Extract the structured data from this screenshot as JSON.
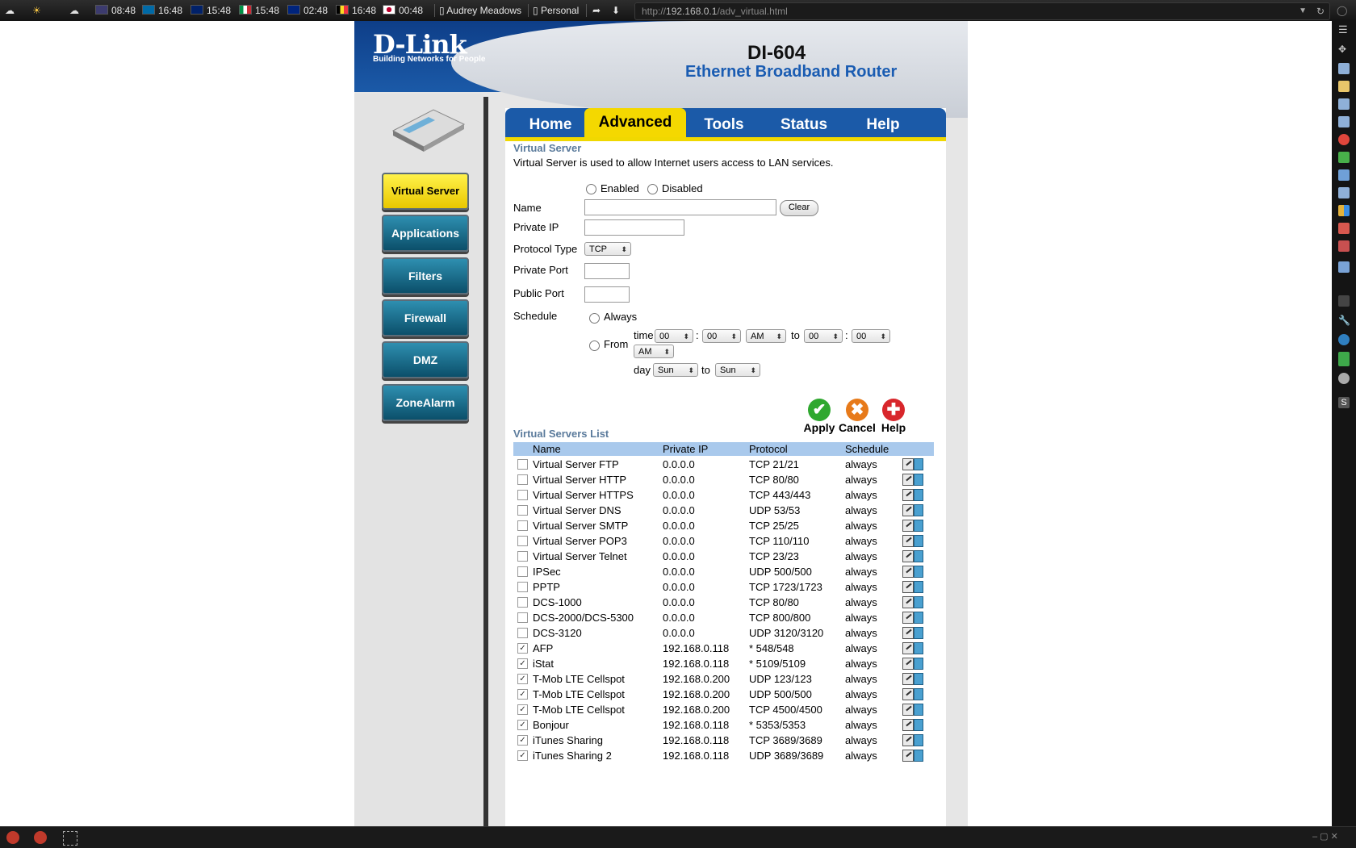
{
  "system_bar": {
    "clocks": [
      {
        "flag": "us",
        "time": "08:48"
      },
      {
        "flag": "se",
        "time": "16:48"
      },
      {
        "flag": "gb",
        "time": "15:48"
      },
      {
        "flag": "it",
        "time": "15:48"
      },
      {
        "flag": "au",
        "time": "02:48"
      },
      {
        "flag": "be",
        "time": "16:48"
      },
      {
        "flag": "jp",
        "time": "00:48"
      }
    ],
    "user": "Audrey Meadows",
    "profile": "Personal"
  },
  "browser": {
    "url_prefix": "http://",
    "url_host": "192.168.0.1",
    "url_path": "/adv_virtual.html"
  },
  "router": {
    "brand": "D-Link",
    "tagline": "Building Networks for People",
    "model": "DI-604",
    "product": "Ethernet Broadband Router"
  },
  "sidebar": {
    "items": [
      {
        "label": "Virtual Server",
        "active": true
      },
      {
        "label": "Applications",
        "active": false
      },
      {
        "label": "Filters",
        "active": false
      },
      {
        "label": "Firewall",
        "active": false
      },
      {
        "label": "DMZ",
        "active": false
      },
      {
        "label": "ZoneAlarm",
        "active": false
      }
    ]
  },
  "tabs": [
    {
      "label": "Home",
      "active": false
    },
    {
      "label": "Advanced",
      "active": true
    },
    {
      "label": "Tools",
      "active": false
    },
    {
      "label": "Status",
      "active": false
    },
    {
      "label": "Help",
      "active": false
    }
  ],
  "form": {
    "title": "Virtual Server",
    "description": "Virtual Server is used to allow Internet users access to LAN services.",
    "enabled_label": "Enabled",
    "disabled_label": "Disabled",
    "name_label": "Name",
    "name_value": "",
    "clear_label": "Clear",
    "private_ip_label": "Private IP",
    "private_ip_value": "",
    "protocol_label": "Protocol Type",
    "protocol_value": "TCP",
    "private_port_label": "Private Port",
    "private_port_value": "",
    "public_port_label": "Public Port",
    "public_port_value": "",
    "schedule_label": "Schedule",
    "always_label": "Always",
    "from_label": "From",
    "time_label": "time",
    "colon": ":",
    "to_label": "to",
    "day_label": "day",
    "from_hour": "00",
    "from_min": "00",
    "from_ampm": "AM",
    "to_hour": "00",
    "to_min": "00",
    "to_ampm": "AM",
    "from_day": "Sun",
    "to_day": "Sun"
  },
  "actions": {
    "apply": "Apply",
    "cancel": "Cancel",
    "help": "Help",
    "apply_color": "#2fa82f",
    "cancel_color": "#e77a1a",
    "help_color": "#d8262b"
  },
  "list": {
    "title": "Virtual Servers List",
    "columns": [
      "Name",
      "Private IP",
      "Protocol",
      "Schedule"
    ],
    "rows": [
      {
        "checked": false,
        "name": "Virtual Server FTP",
        "ip": "0.0.0.0",
        "protocol": "TCP 21/21",
        "schedule": "always"
      },
      {
        "checked": false,
        "name": "Virtual Server HTTP",
        "ip": "0.0.0.0",
        "protocol": "TCP 80/80",
        "schedule": "always"
      },
      {
        "checked": false,
        "name": "Virtual Server HTTPS",
        "ip": "0.0.0.0",
        "protocol": "TCP 443/443",
        "schedule": "always"
      },
      {
        "checked": false,
        "name": "Virtual Server DNS",
        "ip": "0.0.0.0",
        "protocol": "UDP 53/53",
        "schedule": "always"
      },
      {
        "checked": false,
        "name": "Virtual Server SMTP",
        "ip": "0.0.0.0",
        "protocol": "TCP 25/25",
        "schedule": "always"
      },
      {
        "checked": false,
        "name": "Virtual Server POP3",
        "ip": "0.0.0.0",
        "protocol": "TCP 110/110",
        "schedule": "always"
      },
      {
        "checked": false,
        "name": "Virtual Server Telnet",
        "ip": "0.0.0.0",
        "protocol": "TCP 23/23",
        "schedule": "always"
      },
      {
        "checked": false,
        "name": "IPSec",
        "ip": "0.0.0.0",
        "protocol": "UDP 500/500",
        "schedule": "always"
      },
      {
        "checked": false,
        "name": "PPTP",
        "ip": "0.0.0.0",
        "protocol": "TCP 1723/1723",
        "schedule": "always"
      },
      {
        "checked": false,
        "name": "DCS-1000",
        "ip": "0.0.0.0",
        "protocol": "TCP 80/80",
        "schedule": "always"
      },
      {
        "checked": false,
        "name": "DCS-2000/DCS-5300",
        "ip": "0.0.0.0",
        "protocol": "TCP 800/800",
        "schedule": "always"
      },
      {
        "checked": false,
        "name": "DCS-3120",
        "ip": "0.0.0.0",
        "protocol": "UDP 3120/3120",
        "schedule": "always"
      },
      {
        "checked": true,
        "name": "AFP",
        "ip": "192.168.0.118",
        "protocol": "* 548/548",
        "schedule": "always"
      },
      {
        "checked": true,
        "name": "iStat",
        "ip": "192.168.0.118",
        "protocol": "* 5109/5109",
        "schedule": "always"
      },
      {
        "checked": true,
        "name": "T-Mob LTE Cellspot",
        "ip": "192.168.0.200",
        "protocol": "UDP 123/123",
        "schedule": "always"
      },
      {
        "checked": true,
        "name": "T-Mob LTE Cellspot",
        "ip": "192.168.0.200",
        "protocol": "UDP 500/500",
        "schedule": "always"
      },
      {
        "checked": true,
        "name": "T-Mob LTE Cellspot",
        "ip": "192.168.0.200",
        "protocol": "TCP 4500/4500",
        "schedule": "always"
      },
      {
        "checked": true,
        "name": "Bonjour",
        "ip": "192.168.0.118",
        "protocol": "* 5353/5353",
        "schedule": "always"
      },
      {
        "checked": true,
        "name": "iTunes Sharing",
        "ip": "192.168.0.118",
        "protocol": "TCP 3689/3689",
        "schedule": "always"
      },
      {
        "checked": true,
        "name": "iTunes Sharing 2",
        "ip": "192.168.0.118",
        "protocol": "UDP 3689/3689",
        "schedule": "always"
      }
    ]
  }
}
